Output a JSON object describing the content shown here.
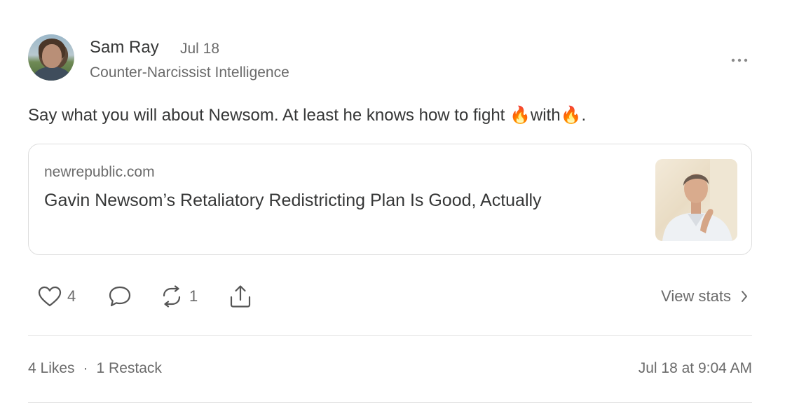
{
  "author": {
    "name": "Sam Ray",
    "date": "Jul 18",
    "publication": "Counter-Narcissist Intelligence"
  },
  "post": {
    "text": "Say what you will about Newsom. At least he knows how to fight 🔥with🔥."
  },
  "link_card": {
    "domain": "newrepublic.com",
    "title": "Gavin Newsom’s Retaliatory Redistricting Plan Is Good, Actually"
  },
  "actions": {
    "like_count": "4",
    "restack_count": "1",
    "view_stats_label": "View stats"
  },
  "footer": {
    "likes": "4 Likes",
    "separator": "·",
    "restacks": "1 Restack",
    "timestamp": "Jul 18 at 9:04 AM"
  },
  "icons": [
    "ellipsis-icon",
    "heart-icon",
    "comment-icon",
    "restack-icon",
    "share-icon",
    "chevron-right-icon"
  ],
  "colors": {
    "text": "#363737",
    "muted": "#6b6b6b",
    "border": "#dedede"
  }
}
